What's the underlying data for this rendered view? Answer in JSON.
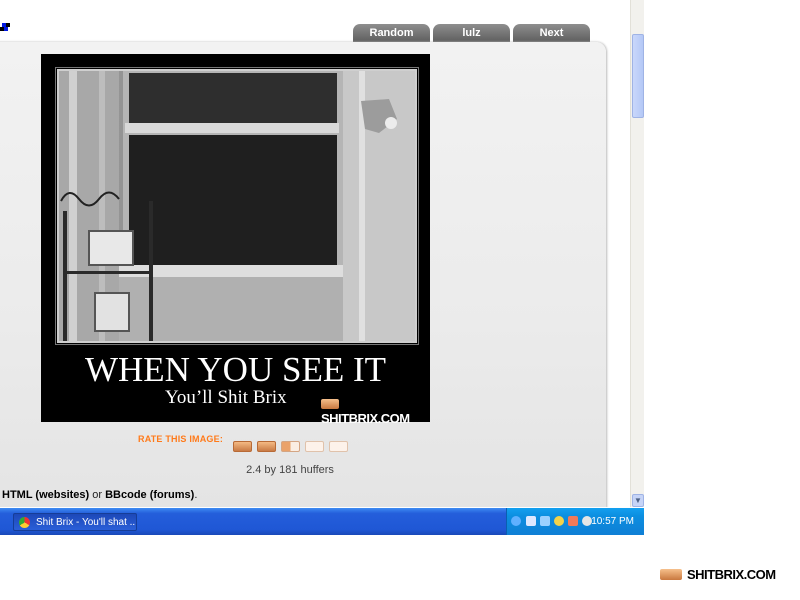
{
  "nav": {
    "random_label": "Random",
    "lulz_label": "lulz",
    "next_label": "Next"
  },
  "poster": {
    "headline": "WHEN YOU SEE IT",
    "subline": "You’ll Shit Brix",
    "watermark": "SHITBRIX.COM"
  },
  "rating": {
    "label": "RATE THIS IMAGE:",
    "score_text": "2.4 by 181 huffers",
    "bricks": [
      "full",
      "full",
      "half",
      "empty",
      "empty"
    ]
  },
  "embed": {
    "html_label": "HTML (websites)",
    "or_text": "or",
    "bbcode_label": "BBcode (forums)",
    "period": "."
  },
  "taskbar": {
    "window_title": "Shit Brix - You'll shat ...",
    "clock": "10:57 PM"
  },
  "bottom_watermark": "SHITBRIX.COM",
  "colors": {
    "rate_label": "#ff7a1a",
    "tab": "#6e6e6e",
    "taskbar": "#245edb",
    "tray": "#0f8ee0"
  }
}
